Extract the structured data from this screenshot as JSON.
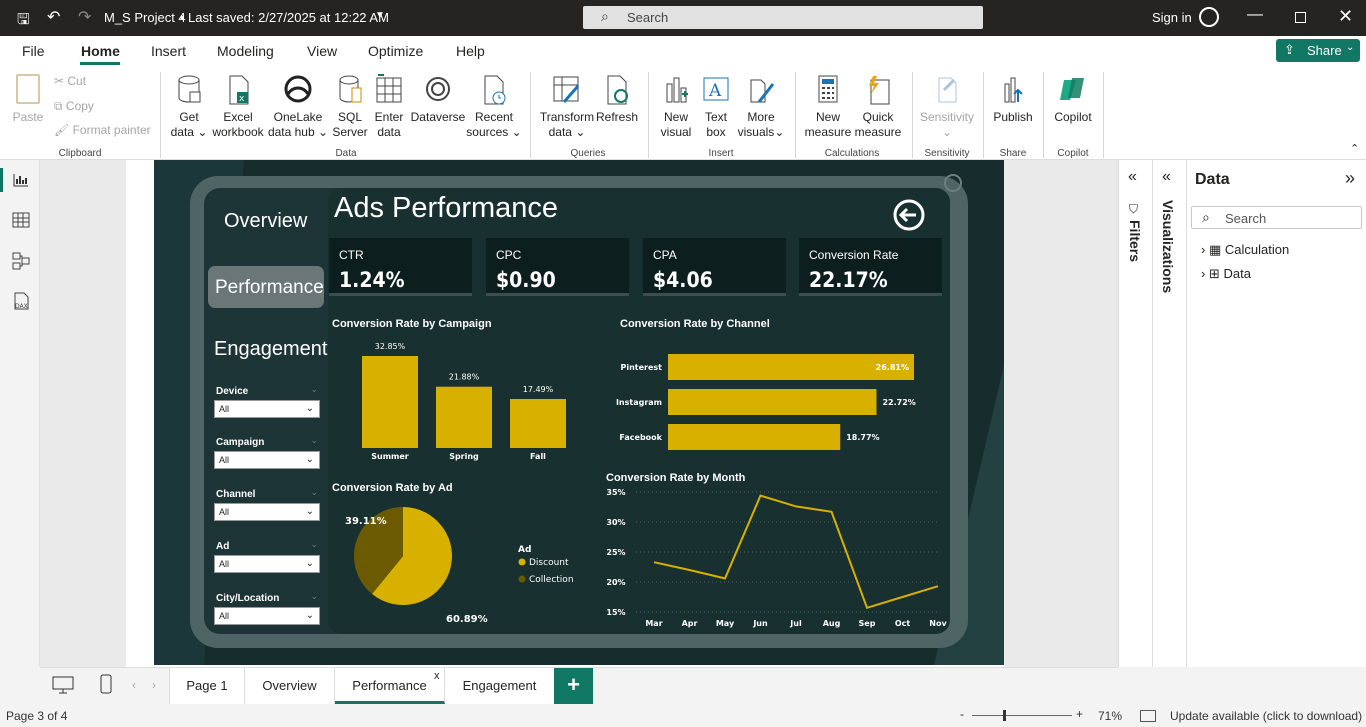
{
  "titlebar": {
    "doc_title": "M_S Project 4",
    "saved": "Last saved: 2/27/2025 at 12:22 AM",
    "search_placeholder": "Search",
    "sign_in": "Sign in"
  },
  "menubar": {
    "items": [
      "File",
      "Home",
      "Insert",
      "Modeling",
      "View",
      "Optimize",
      "Help"
    ],
    "active": "Home",
    "share": "Share"
  },
  "ribbon": {
    "clipboard": {
      "paste": "Paste",
      "cut": "Cut",
      "copy": "Copy",
      "format_painter": "Format painter",
      "group": "Clipboard"
    },
    "data": {
      "get_data": [
        "Get",
        "data"
      ],
      "excel": [
        "Excel",
        "workbook"
      ],
      "onelake": [
        "OneLake",
        "data hub"
      ],
      "sql": [
        "SQL",
        "Server"
      ],
      "enter": [
        "Enter",
        "data"
      ],
      "dataverse": "Dataverse",
      "recent": [
        "Recent",
        "sources"
      ],
      "group": "Data"
    },
    "queries": {
      "transform": [
        "Transform",
        "data"
      ],
      "refresh": "Refresh",
      "group": "Queries"
    },
    "insert": {
      "new_visual": [
        "New",
        "visual"
      ],
      "text_box": [
        "Text",
        "box"
      ],
      "more_visuals": [
        "More",
        "visuals"
      ],
      "group": "Insert"
    },
    "calculations": {
      "new_measure": [
        "New",
        "measure"
      ],
      "quick_measure": [
        "Quick",
        "measure"
      ],
      "group": "Calculations"
    },
    "sensitivity": {
      "label": "Sensitivity",
      "group": "Sensitivity"
    },
    "share": {
      "publish": "Publish",
      "group": "Share"
    },
    "copilot": {
      "label": "Copilot",
      "group": "Copilot"
    }
  },
  "report": {
    "title": "Ads Performance",
    "nav": {
      "overview": "Overview",
      "performance": "Performance",
      "engagement": "Engagement"
    },
    "kpis": [
      {
        "label": "CTR",
        "value": "1.24%"
      },
      {
        "label": "CPC",
        "value": "$0.90"
      },
      {
        "label": "CPA",
        "value": "$4.06"
      },
      {
        "label": "Conversion Rate",
        "value": "22.17%"
      }
    ],
    "slicers": [
      {
        "label": "Device",
        "value": "All"
      },
      {
        "label": "Campaign",
        "value": "All"
      },
      {
        "label": "Channel",
        "value": "All"
      },
      {
        "label": "Ad",
        "value": "All"
      },
      {
        "label": "City/Location",
        "value": "All"
      }
    ]
  },
  "chart_data": [
    {
      "type": "bar",
      "title": "Conversion Rate by Campaign",
      "categories": [
        "Summer",
        "Spring",
        "Fall"
      ],
      "values": [
        32.85,
        21.88,
        17.49
      ],
      "data_labels": [
        "32.85%",
        "21.88%",
        "17.49%"
      ],
      "color": "#d8b100"
    },
    {
      "type": "bar",
      "orientation": "horizontal",
      "title": "Conversion Rate by Channel",
      "categories": [
        "Pinterest",
        "Instagram",
        "Facebook"
      ],
      "values": [
        26.81,
        22.72,
        18.77
      ],
      "data_labels": [
        "26.81%",
        "22.72%",
        "18.77%"
      ],
      "color": "#d8b100"
    },
    {
      "type": "pie",
      "title": "Conversion Rate by Ad",
      "legend_title": "Ad",
      "labels": [
        "Discount",
        "Collection"
      ],
      "values": [
        60.89,
        39.11
      ],
      "data_labels": [
        "60.89%",
        "39.11%"
      ],
      "colors": [
        "#d8b100",
        "#6b5a00"
      ]
    },
    {
      "type": "line",
      "title": "Conversion Rate by Month",
      "x": [
        "Mar",
        "Apr",
        "May",
        "Jun",
        "Jul",
        "Aug",
        "Sep",
        "Oct",
        "Nov"
      ],
      "y": [
        23.3,
        22.0,
        20.6,
        34.4,
        32.6,
        31.7,
        15.7,
        17.5,
        19.3
      ],
      "yticks": [
        "35%",
        "30%",
        "25%",
        "20%",
        "15%"
      ],
      "ylim": [
        15,
        35
      ],
      "color": "#d8b100"
    }
  ],
  "panes": {
    "filters": "Filters",
    "visualizations": "Visualizations",
    "data_title": "Data",
    "data_search": "Search",
    "tree": [
      "Calculation",
      "Data"
    ]
  },
  "tabs": [
    "Page 1",
    "Overview",
    "Performance",
    "Engagement"
  ],
  "active_tab": "Performance",
  "status": {
    "page": "Page 3 of 4",
    "zoom": "71%",
    "update": "Update available (click to download)"
  }
}
